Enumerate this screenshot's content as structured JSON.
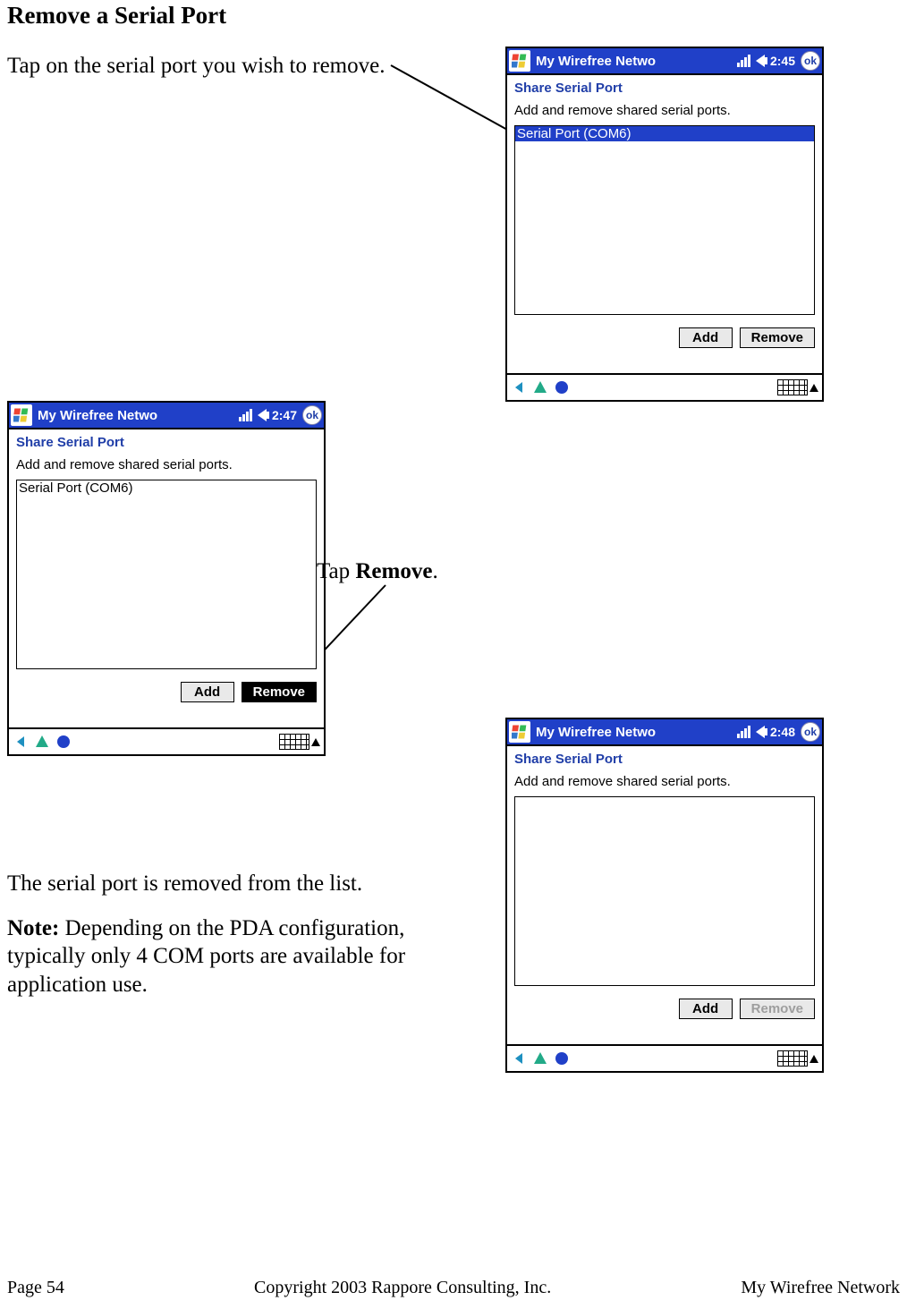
{
  "heading": "Remove a Serial Port",
  "intro": "Tap on the serial port you wish to remove.",
  "callout_tap": "Tap ",
  "callout_remove": "Remove",
  "callout_period": ".",
  "removed_text": "The serial port is removed from the list.",
  "note_label": "Note:",
  "note_text": " Depending on the PDA configuration, typically only 4 COM ports are available for application use.",
  "footer": {
    "page": "Page 54",
    "copyright": "Copyright 2003 Rappore Consulting, Inc.",
    "title": "My Wirefree Network"
  },
  "pda1": {
    "title": "My Wirefree Netwo",
    "time": "2:45",
    "ok": "ok",
    "subtitle": "Share Serial Port",
    "desc": "Add and remove shared serial ports.",
    "list": {
      "item": "Serial Port (COM6)"
    },
    "buttons": {
      "add": "Add",
      "remove": "Remove"
    }
  },
  "pda2": {
    "title": "My Wirefree Netwo",
    "time": "2:47",
    "ok": "ok",
    "subtitle": "Share Serial Port",
    "desc": "Add and remove shared serial ports.",
    "list": {
      "item": "Serial Port (COM6)"
    },
    "buttons": {
      "add": "Add",
      "remove": "Remove"
    }
  },
  "pda3": {
    "title": "My Wirefree Netwo",
    "time": "2:48",
    "ok": "ok",
    "subtitle": "Share Serial Port",
    "desc": "Add and remove shared serial ports.",
    "buttons": {
      "add": "Add",
      "remove": "Remove"
    }
  }
}
